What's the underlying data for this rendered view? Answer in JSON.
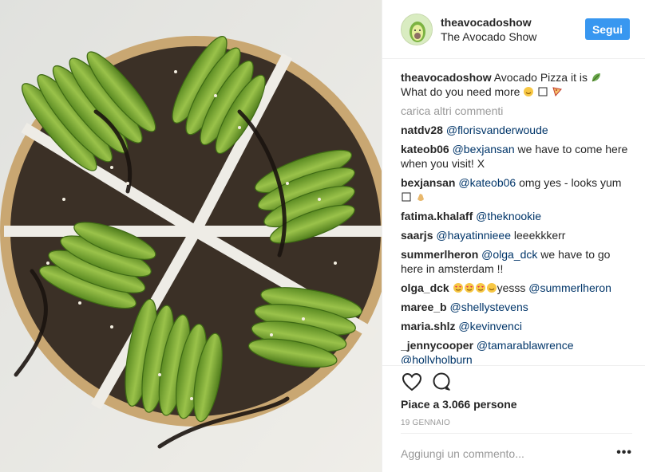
{
  "post": {
    "image_alt": "Avocado pizza slices",
    "header": {
      "username": "theavocadoshow",
      "full_name": "The Avocado Show",
      "follow_label": "Segui",
      "avatar_icon": "avocado-logo-icon"
    },
    "caption": {
      "username": "theavocadoshow",
      "text": "Avocado Pizza it is",
      "text2": "What do you need more"
    },
    "load_more": "carica altri commenti",
    "comments": [
      {
        "user": "natdv28",
        "mention": "@florisvanderwoude",
        "text": ""
      },
      {
        "user": "kateob06",
        "mention": "@bexjansan",
        "text": "we have to come here when you visit! X"
      },
      {
        "user": "bexjansan",
        "mention": "@kateob06",
        "text": "omg yes - looks yum"
      },
      {
        "user": "fatima.khalaff",
        "mention": "@theknookie",
        "text": ""
      },
      {
        "user": "saarjs",
        "mention": "@hayatinnieee",
        "text": "leeekkkerr"
      },
      {
        "user": "summerlheron",
        "mention": "@olga_dck",
        "text": "we have to go here in amsterdam !!"
      },
      {
        "user": "olga_dck",
        "mention": "@summerlheron",
        "text": "yesss"
      },
      {
        "user": "maree_b",
        "mention": "@shellystevens",
        "text": ""
      },
      {
        "user": "maria.shlz",
        "mention": "@kevinvenci",
        "text": ""
      },
      {
        "user": "_jennycooper",
        "mention": "@tamarablawrence",
        "text": ""
      },
      {
        "user": "",
        "mention": "@hollyholburn",
        "text": ""
      }
    ],
    "actions": {
      "like_icon": "heart-icon",
      "comment_icon": "speech-bubble-icon",
      "likes_text": "Piace a 3.066 persone",
      "date": "19 GENNAIO"
    },
    "add_comment": {
      "placeholder": "Aggiungi un commento...",
      "more_label": "•••"
    }
  }
}
